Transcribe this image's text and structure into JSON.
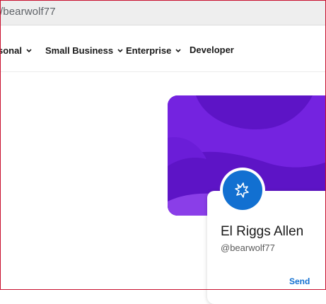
{
  "browser": {
    "url": "/bearwolf77"
  },
  "nav": {
    "items": [
      {
        "label": "sonal",
        "has_dropdown": true
      },
      {
        "label": "Small Business",
        "has_dropdown": true
      },
      {
        "label": "Enterprise",
        "has_dropdown": true
      },
      {
        "label": "Developer",
        "has_dropdown": false
      }
    ]
  },
  "profile": {
    "name": "El Riggs Allen",
    "handle": "@bearwolf77",
    "avatar_icon": "wolf-icon",
    "send_label": "Send"
  },
  "colors": {
    "banner": "#6a1fd6",
    "avatar_bg": "#1270d1",
    "link": "#1270d1"
  }
}
